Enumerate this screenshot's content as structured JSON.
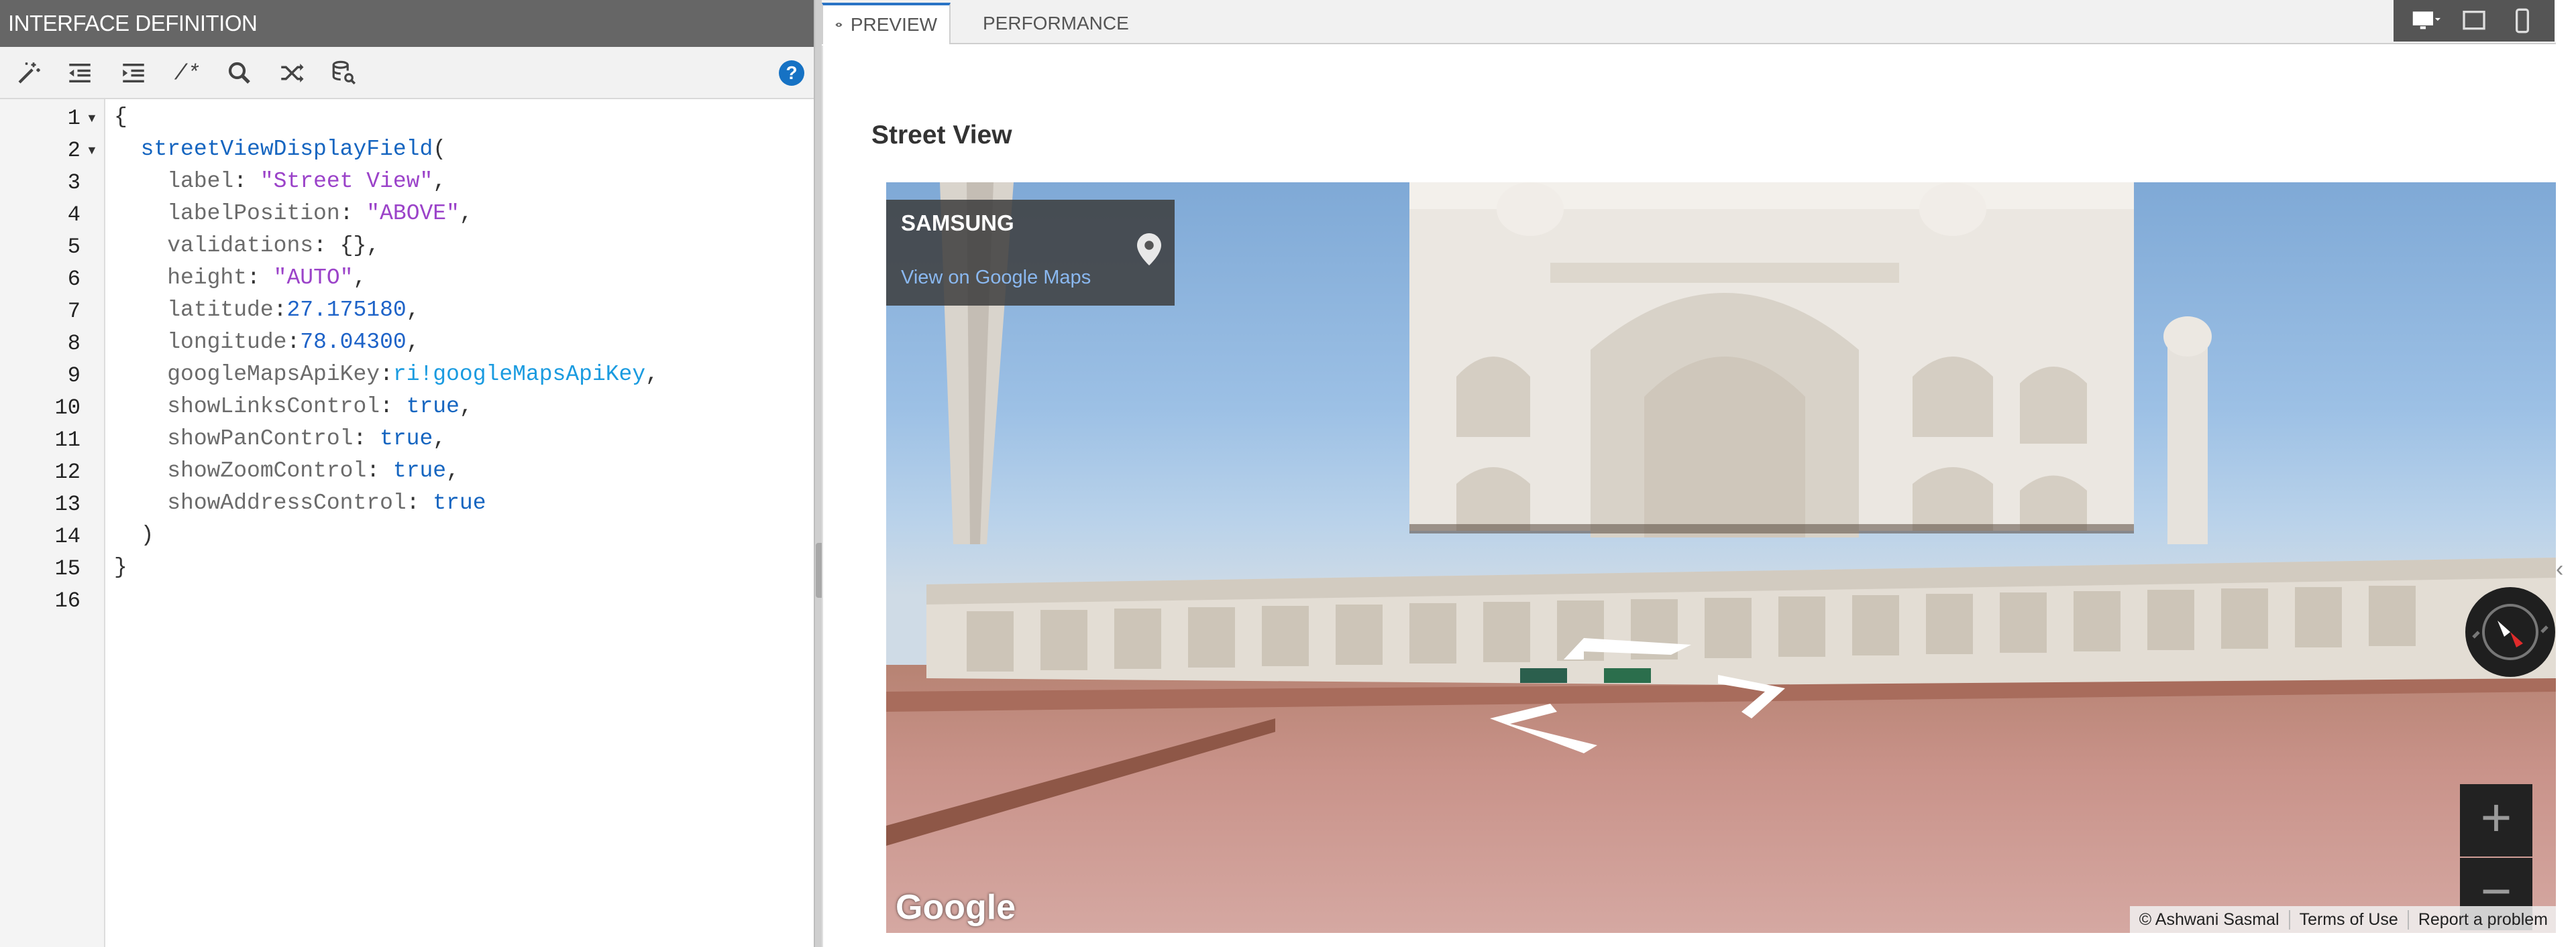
{
  "left_panel": {
    "title": "INTERFACE DEFINITION",
    "toolbar": {
      "icons": [
        "magic-wand-icon",
        "outdent-icon",
        "indent-icon",
        "comment-icon",
        "search-icon",
        "shuffle-icon",
        "database-search-icon"
      ],
      "comment_glyph": "/*",
      "help_glyph": "?"
    },
    "editor": {
      "line_numbers": [
        "1",
        "2",
        "3",
        "4",
        "5",
        "6",
        "7",
        "8",
        "9",
        "10",
        "11",
        "12",
        "13",
        "14",
        "15",
        "16"
      ],
      "code": {
        "l1": "{",
        "l2_fn": "streetViewDisplayField",
        "l2_open": "(",
        "l3_key": "label",
        "l3_val": "\"Street View\"",
        "l4_key": "labelPosition",
        "l4_val": "\"ABOVE\"",
        "l5_key": "validations",
        "l5_val": "{}",
        "l6_key": "height",
        "l6_val": "\"AUTO\"",
        "l7_key": "latitude",
        "l7_val": "27.175180",
        "l8_key": "longitude",
        "l8_val": "78.04300",
        "l9_key": "googleMapsApiKey",
        "l9_val": "ri!googleMapsApiKey",
        "l10_key": "showLinksControl",
        "l10_val": "true",
        "l11_key": "showPanControl",
        "l11_val": "true",
        "l12_key": "showZoomControl",
        "l12_val": "true",
        "l13_key": "showAddressControl",
        "l13_val": "true",
        "l14": ")",
        "l15": "}"
      }
    }
  },
  "right_panel": {
    "tabs": [
      {
        "label": "PREVIEW",
        "icon": "eye-icon",
        "active": true
      },
      {
        "label": "PERFORMANCE",
        "icon": "clock-icon",
        "active": false
      }
    ],
    "device_icons": [
      "desktop-icon",
      "tablet-icon",
      "phone-icon"
    ],
    "field_label": "Street View",
    "street_view": {
      "info_title": "SAMSUNG",
      "info_link": "View on Google Maps",
      "brand": "Google",
      "footer": [
        "© Ashwani Sasmal",
        "Terms of Use",
        "Report a problem"
      ],
      "zoom_in": "+",
      "zoom_out": "−"
    }
  }
}
